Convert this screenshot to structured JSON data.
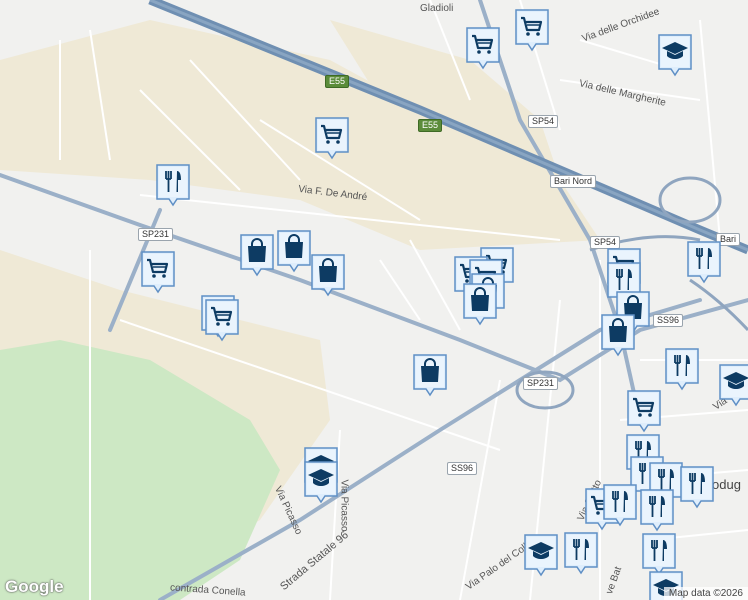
{
  "map": {
    "colors": {
      "background": "#f1f1ef",
      "farmland": "#efe9d6",
      "park": "#cde8c4",
      "motorway": "#6f8fb2",
      "major_road": "#8fa5bf",
      "minor_road": "#ffffff",
      "marker_fill": "#dfeefc",
      "marker_border": "#5f8fc5",
      "marker_icon": "#0d3b63"
    },
    "street_labels": [
      {
        "id": "gladioli",
        "text": "Gladioli"
      },
      {
        "id": "orchidee",
        "text": "Via delle Orchidee"
      },
      {
        "id": "margherite",
        "text": "Via delle Margherite"
      },
      {
        "id": "deandre",
        "text": "Via F. De André"
      },
      {
        "id": "picasso1",
        "text": "Via Picasso"
      },
      {
        "id": "picasso2",
        "text": "Via Picasso"
      },
      {
        "id": "statale",
        "text": "Strada Statale 96"
      },
      {
        "id": "conella",
        "text": "contrada Conella"
      },
      {
        "id": "palocolle",
        "text": "Via Palo del Colle"
      },
      {
        "id": "giotto",
        "text": "Via Giotto"
      },
      {
        "id": "modugno",
        "text": "odug"
      },
      {
        "id": "bat",
        "text": "ve Bat"
      },
      {
        "id": "gi",
        "text": "Via Gi"
      }
    ],
    "shields": [
      {
        "id": "e55a",
        "text": "E55",
        "kind": "euro"
      },
      {
        "id": "e55b",
        "text": "E55",
        "kind": "euro"
      },
      {
        "id": "sp54a",
        "text": "SP54",
        "kind": "route"
      },
      {
        "id": "barinord",
        "text": "Bari Nord",
        "kind": "route"
      },
      {
        "id": "sp231a",
        "text": "SP231",
        "kind": "route"
      },
      {
        "id": "sp54b",
        "text": "SP54",
        "kind": "route"
      },
      {
        "id": "bari",
        "text": "Bari",
        "kind": "route"
      },
      {
        "id": "ss96a",
        "text": "SS96",
        "kind": "route"
      },
      {
        "id": "sp231b",
        "text": "SP231",
        "kind": "route"
      },
      {
        "id": "ss96b",
        "text": "SS96",
        "kind": "route"
      }
    ],
    "markers": [
      {
        "type": "shopping-cart"
      },
      {
        "type": "shopping-cart"
      },
      {
        "type": "graduation-cap"
      },
      {
        "type": "shopping-cart"
      },
      {
        "type": "restaurant"
      },
      {
        "type": "shopping-bag"
      },
      {
        "type": "shopping-bag"
      },
      {
        "type": "shopping-bag"
      },
      {
        "type": "shopping-cart"
      },
      {
        "type": "shopping-cart"
      },
      {
        "type": "shopping-cart"
      },
      {
        "type": "shopping-cart"
      },
      {
        "type": "shopping-cart"
      },
      {
        "type": "shopping-cart"
      },
      {
        "type": "shopping-bag"
      },
      {
        "type": "shopping-bag"
      },
      {
        "type": "shopping-cart"
      },
      {
        "type": "restaurant"
      },
      {
        "type": "restaurant"
      },
      {
        "type": "shopping-bag"
      },
      {
        "type": "restaurant"
      },
      {
        "type": "graduation-cap"
      },
      {
        "type": "shopping-cart"
      },
      {
        "type": "restaurant"
      },
      {
        "type": "restaurant"
      },
      {
        "type": "restaurant"
      },
      {
        "type": "restaurant"
      },
      {
        "type": "shopping-cart"
      },
      {
        "type": "restaurant"
      },
      {
        "type": "restaurant"
      },
      {
        "type": "graduation-cap"
      },
      {
        "type": "restaurant"
      },
      {
        "type": "restaurant"
      },
      {
        "type": "graduation-cap"
      },
      {
        "type": "graduation-cap"
      }
    ],
    "attribution": "Map data ©2026",
    "logo": "Google"
  }
}
